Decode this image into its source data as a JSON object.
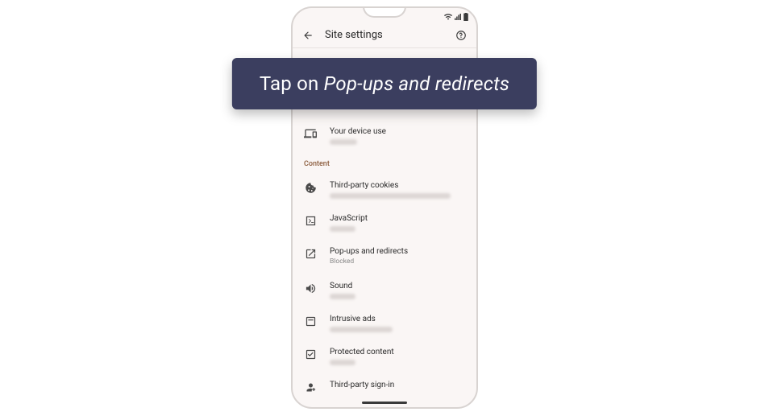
{
  "callout": {
    "prefix": "Tap on ",
    "emphasis": "Pop-ups and redirects"
  },
  "header": {
    "title": "Site settings"
  },
  "sections": {
    "content_label": "Content"
  },
  "rows": {
    "device_use": {
      "label": "Your device use"
    },
    "cookies": {
      "label": "Third-party cookies"
    },
    "javascript": {
      "label": "JavaScript"
    },
    "popups": {
      "label": "Pop-ups and redirects",
      "sub": "Blocked"
    },
    "sound": {
      "label": "Sound"
    },
    "ads": {
      "label": "Intrusive ads"
    },
    "protected": {
      "label": "Protected content"
    },
    "signin": {
      "label": "Third-party sign-in"
    }
  }
}
